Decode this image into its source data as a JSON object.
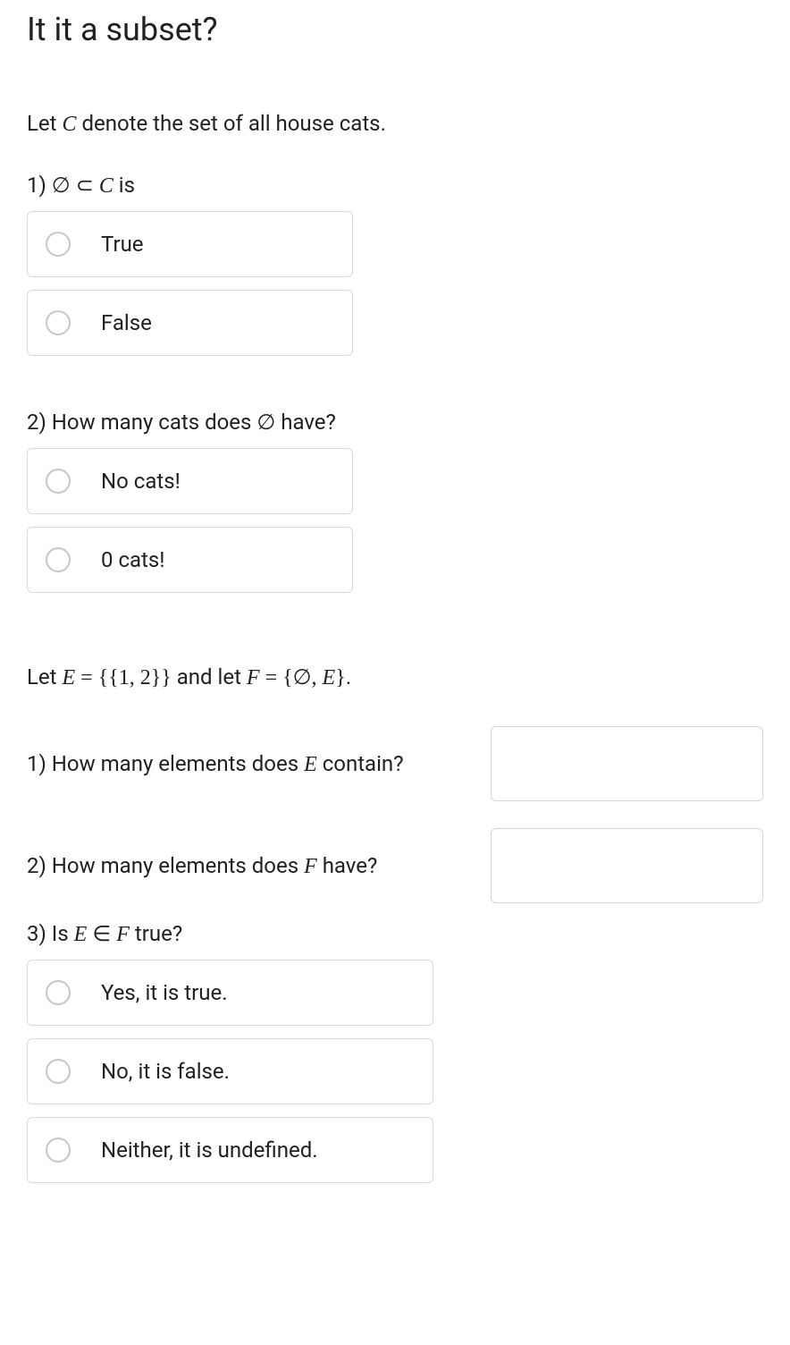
{
  "title": "It it a subset?",
  "intro1_pre": "Let ",
  "intro1_var": "C",
  "intro1_post": " denote the set of all house cats.",
  "q1": {
    "num": "1) ",
    "empty": "∅",
    "sub": " ⊂ ",
    "var": "C",
    "post": " is",
    "opts": {
      "a": "True",
      "b": "False"
    }
  },
  "q2": {
    "pre": "2) How many cats does ",
    "empty": "∅",
    "post": " have?",
    "opts": {
      "a": "No cats!",
      "b": "0 cats!"
    }
  },
  "intro2": {
    "pre": "Let ",
    "E": "E",
    "eq1": " = ",
    "Eset": "{{1, 2}}",
    "mid": " and let ",
    "F": "F",
    "eq2": " = ",
    "Fset": "{∅, E}",
    "dot": "."
  },
  "q3": {
    "pre": "1) How many elements does ",
    "var": "E",
    "post": " contain?"
  },
  "q4": {
    "pre": "2) How many elements does ",
    "var": "F",
    "post": " have?"
  },
  "q5": {
    "pre": "3) Is ",
    "E": "E",
    "in": " ∈ ",
    "F": "F",
    "post": " true?",
    "opts": {
      "a": "Yes, it is true.",
      "b": "No, it is false.",
      "c": "Neither, it is undefined."
    }
  }
}
